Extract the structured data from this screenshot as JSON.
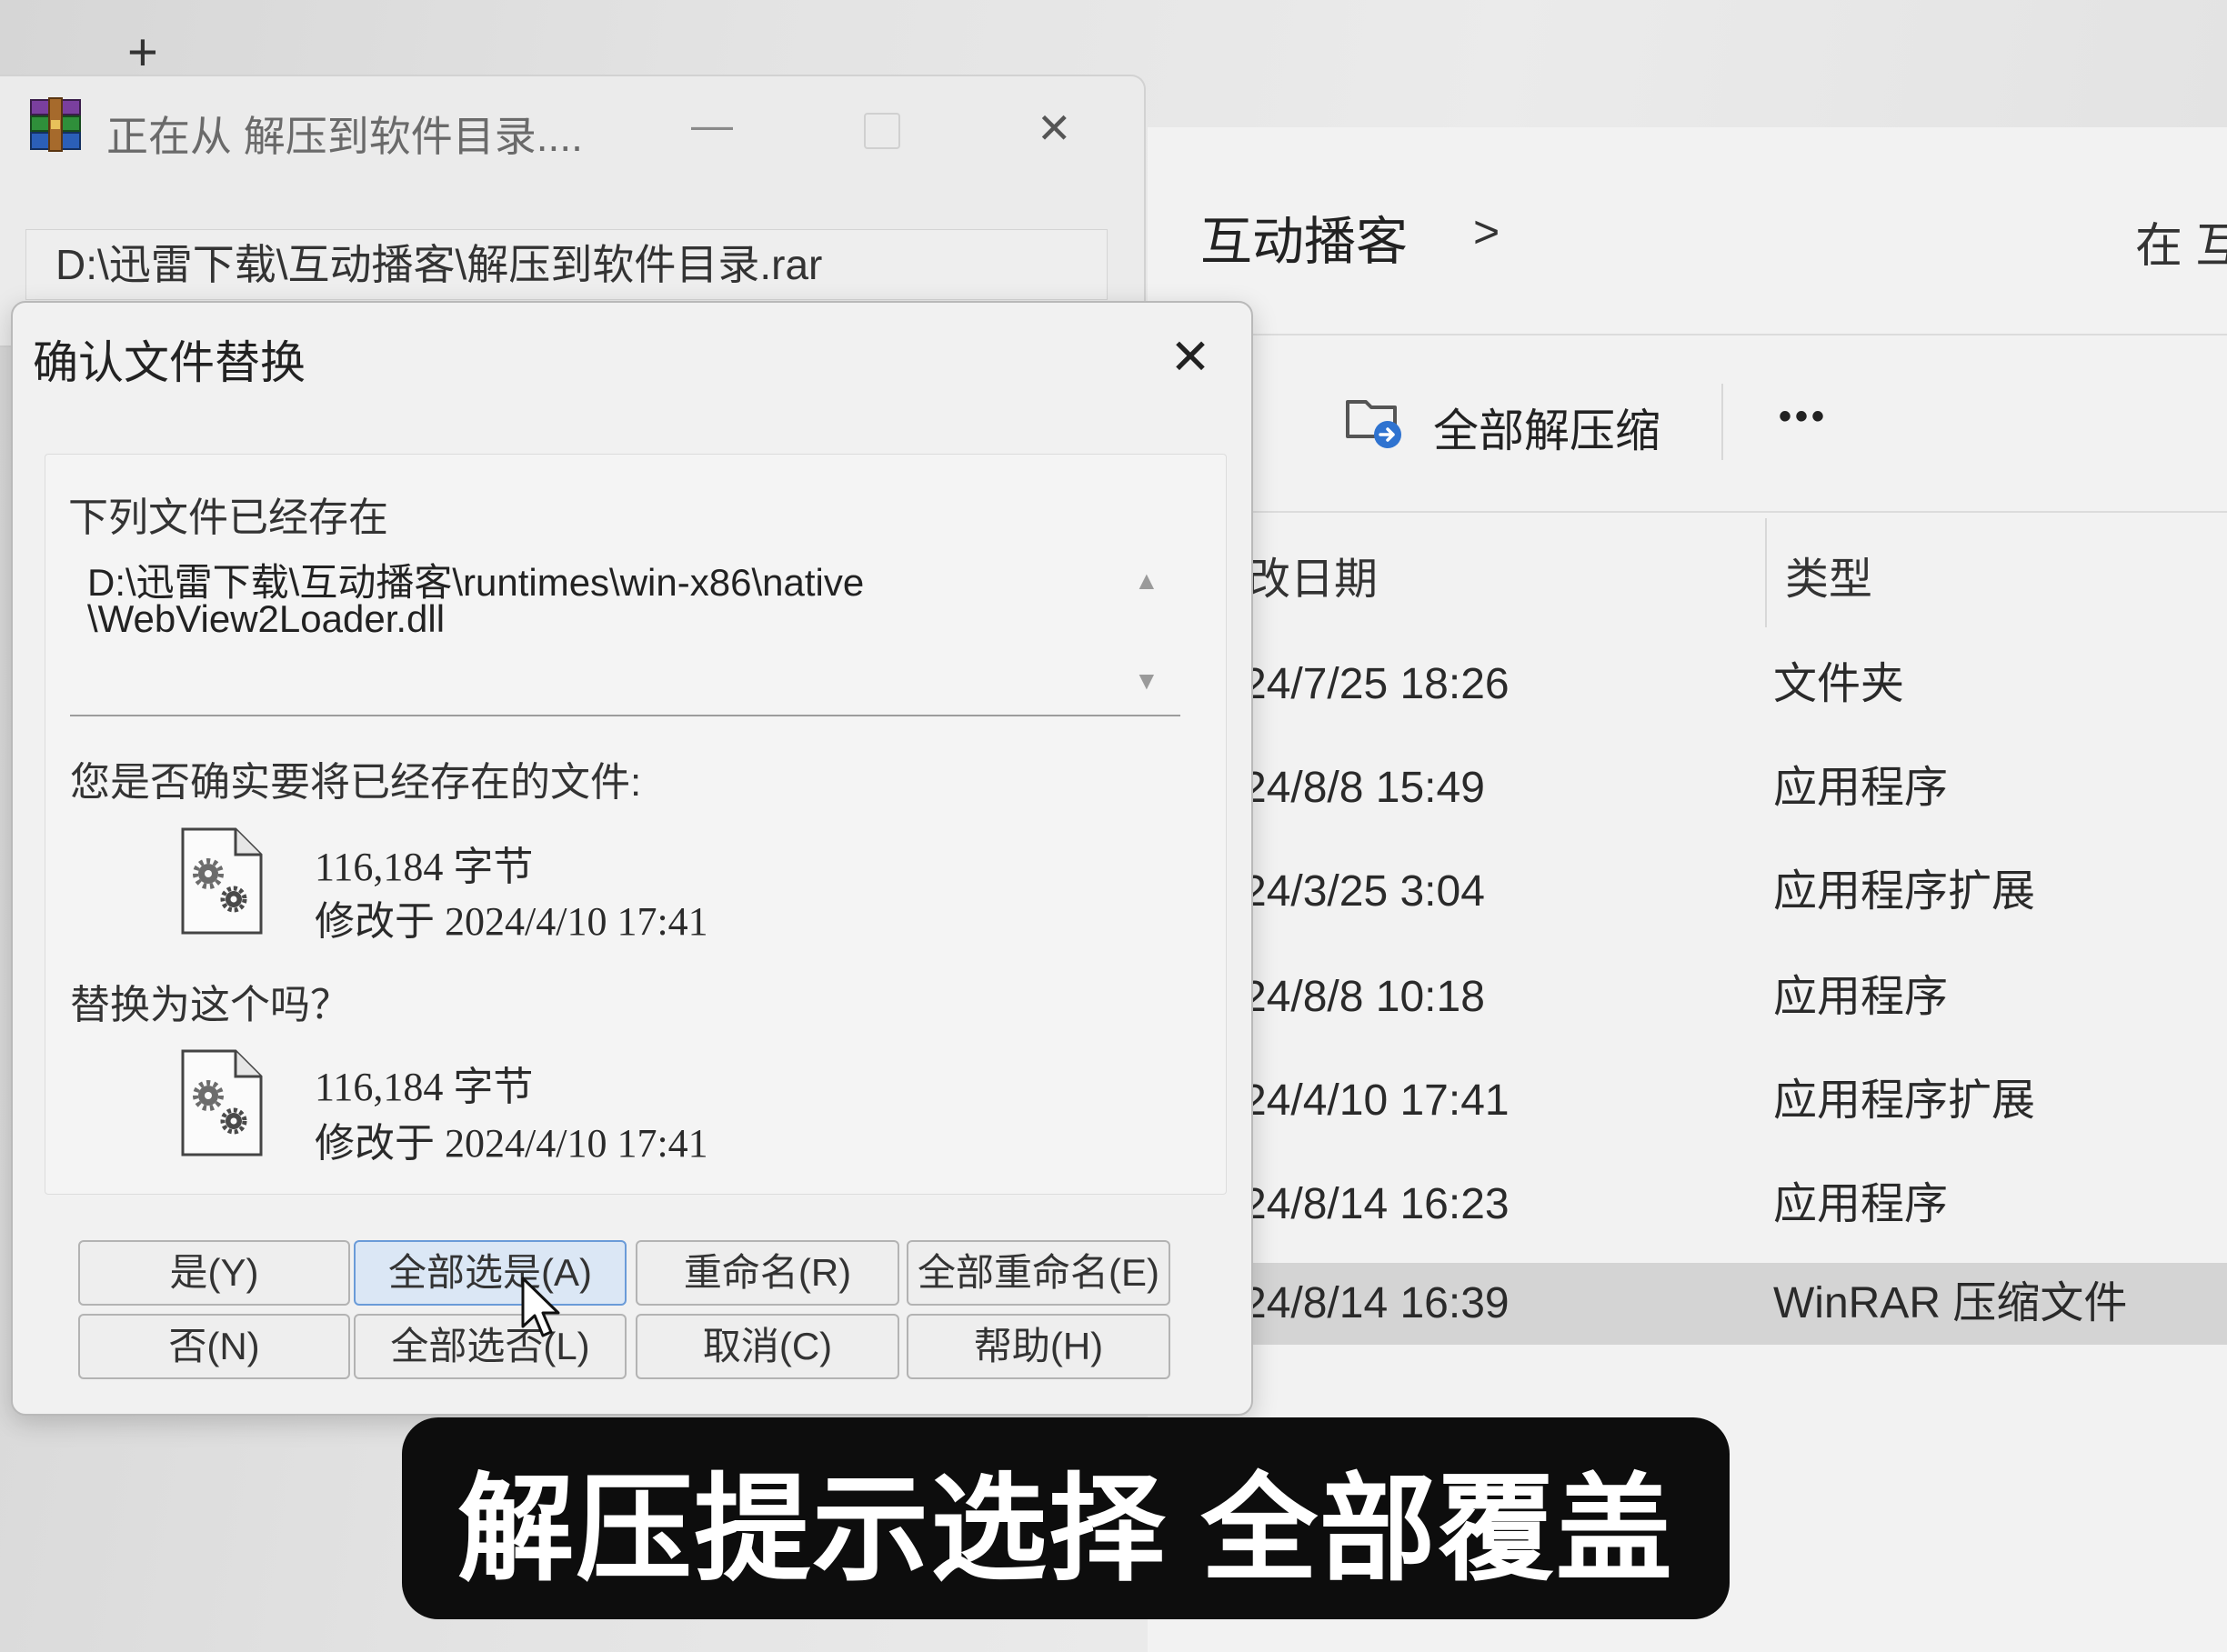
{
  "browser": {
    "new_tab_glyph": "+"
  },
  "progress_window": {
    "icon": "winrar-icon",
    "title": "正在从 解压到软件目录....",
    "minimize_glyph": "—",
    "close_glyph": "✕",
    "archive_path": "D:\\迅雷下载\\互动播客\\解压到软件目录.rar"
  },
  "explorer": {
    "breadcrumb": "互动播客",
    "breadcrumb_separator": ">",
    "search_placeholder": "在 互",
    "toolbar": {
      "extract_all_icon": "folder-extract-icon",
      "extract_all_label": "全部解压缩",
      "more_label": "•••"
    },
    "columns": {
      "modified": "改日期",
      "type": "类型"
    },
    "rows": [
      {
        "date": "24/7/25 18:26",
        "type": "文件夹"
      },
      {
        "date": "24/8/8 15:49",
        "type": "应用程序"
      },
      {
        "date": "24/3/25 3:04",
        "type": "应用程序扩展"
      },
      {
        "date": "24/8/8 10:18",
        "type": "应用程序"
      },
      {
        "date": "24/4/10 17:41",
        "type": "应用程序扩展"
      },
      {
        "date": "24/8/14 16:23",
        "type": "应用程序"
      },
      {
        "date": "24/8/14 16:39",
        "type": "WinRAR 压缩文件",
        "selected": true
      }
    ]
  },
  "dialog": {
    "title": "确认文件替换",
    "close_glyph": "✕",
    "exists_label": "下列文件已经存在",
    "file_path": [
      "D:\\迅雷下载\\互动播客\\runtimes\\win-x86\\native",
      "\\WebView2Loader.dll"
    ],
    "scroll_up_glyph": "▲",
    "scroll_down_glyph": "▼",
    "replace_prompt": "您是否确实要将已经存在的文件:",
    "existing_file": {
      "icon": "dll-file-icon",
      "size": "116,184 字节",
      "modified": "修改于 2024/4/10 17:41"
    },
    "replace_with_prompt": "替换为这个吗？",
    "new_file": {
      "icon": "dll-file-icon",
      "size": "116,184 字节",
      "modified": "修改于 2024/4/10 17:41"
    },
    "buttons": [
      {
        "label": "是(Y)"
      },
      {
        "label": "全部选是(A)",
        "highlighted": true
      },
      {
        "label": "重命名(R)"
      },
      {
        "label": "全部重命名(E)"
      },
      {
        "label": "否(N)"
      },
      {
        "label": "全部选否(L)"
      },
      {
        "label": "取消(C)"
      },
      {
        "label": "帮助(H)"
      }
    ]
  },
  "caption": "解压提示选择 全部覆盖",
  "colors": {
    "caption_bg": "#0d0d0d",
    "caption_text": "#ffffff",
    "highlighted_button": "#dbe7f5",
    "selected_row": "#d4d4d4"
  }
}
